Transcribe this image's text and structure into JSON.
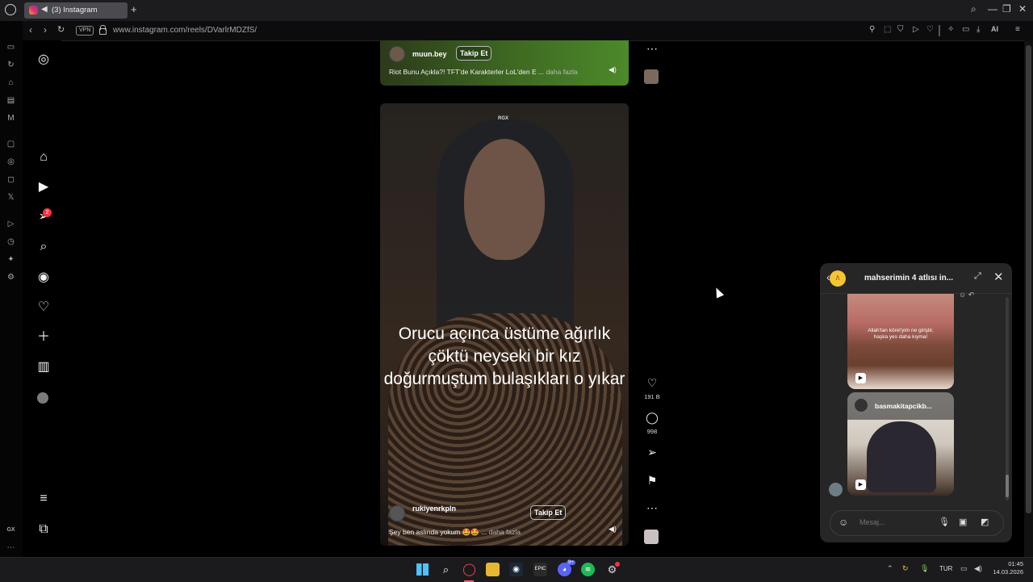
{
  "browser": {
    "tab_title": "(3) Instagram",
    "new_tab": "+",
    "vpn_label": "VPN",
    "url": "www.instagram.com/reels/DVarlrMDZfS/",
    "ai_label": "AI",
    "gx_label": "GX"
  },
  "nav": {
    "notification_count": "2"
  },
  "reel_top": {
    "username": "muun.bey",
    "follow_label": "Takip Et",
    "caption": "Riot Bunu Açıkla?! TFT'de Karakterler LoL'den E ...",
    "more_label": "daha fazla"
  },
  "reel": {
    "watermark": "RGX",
    "overlay_text": "Orucu açınca üstüme ağırlık çöktü neyseki bir kız doğurmuştum bulaşıkları o yıkar",
    "username": "rukiyenrkpln",
    "follow_label": "Takip Et",
    "caption": "Şey ben aslında yokum 🤩🤩 ...",
    "more_label": "daha fazla",
    "likes": "191 B",
    "comments": "998"
  },
  "chat": {
    "title": "mahserimin 4 atlısı in...",
    "message1_text": "Allah'tan körel'yim ne giriştir, haşka yes daha kıyma!",
    "message2_sender": "basmakitapcikb...",
    "input_placeholder": "Mesaj..."
  },
  "taskbar": {
    "language": "TUR",
    "time": "01:45",
    "date": "14.03.2026",
    "discord_badge": "9+"
  }
}
